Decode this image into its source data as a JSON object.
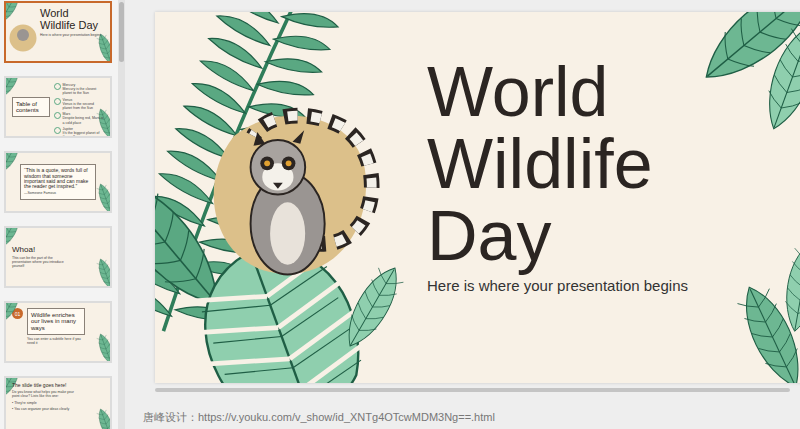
{
  "thumbnails": [
    {
      "kind": "title",
      "selected": true,
      "title": "World Wildlife Day",
      "subtitle": "Here is where your presentation begins"
    },
    {
      "kind": "contents",
      "selected": false,
      "title": "Table of contents",
      "items": [
        {
          "name": "Mercury",
          "text": "Mercury is the closest planet to the Sun"
        },
        {
          "name": "Venus",
          "text": "Venus is the second planet from the Sun"
        },
        {
          "name": "Mars",
          "text": "Despite being red, Mars is a cold place"
        },
        {
          "name": "Jupiter",
          "text": "It's the biggest planet of them all"
        }
      ]
    },
    {
      "kind": "quote",
      "selected": false,
      "quote": "“This is a quote, words full of wisdom that someone important said and can make the reader get inspired.”",
      "author": "—Someone Famous"
    },
    {
      "kind": "whoa",
      "selected": false,
      "title": "Whoa!",
      "text": "This can be the part of the presentation where you introduce yourself"
    },
    {
      "kind": "section",
      "selected": false,
      "badge": "01",
      "title": "Wildlife enriches our lives in many ways",
      "text": "You can enter a subtitle here if you need it"
    },
    {
      "kind": "list",
      "selected": false,
      "title": "The slide title goes here!",
      "text": "Do you know what helps you make your point clear? Lists like this one:",
      "bullets": [
        "They're simple",
        "You can organize your ideas clearly"
      ]
    }
  ],
  "slide": {
    "title_lines": [
      "World",
      "Wildlife",
      "Day"
    ],
    "subtitle": "Here is where your presentation begins"
  },
  "footer": {
    "text": "唐峰设计：https://v.youku.com/v_show/id_XNTg4OTcwMDM3Ng==.html"
  }
}
